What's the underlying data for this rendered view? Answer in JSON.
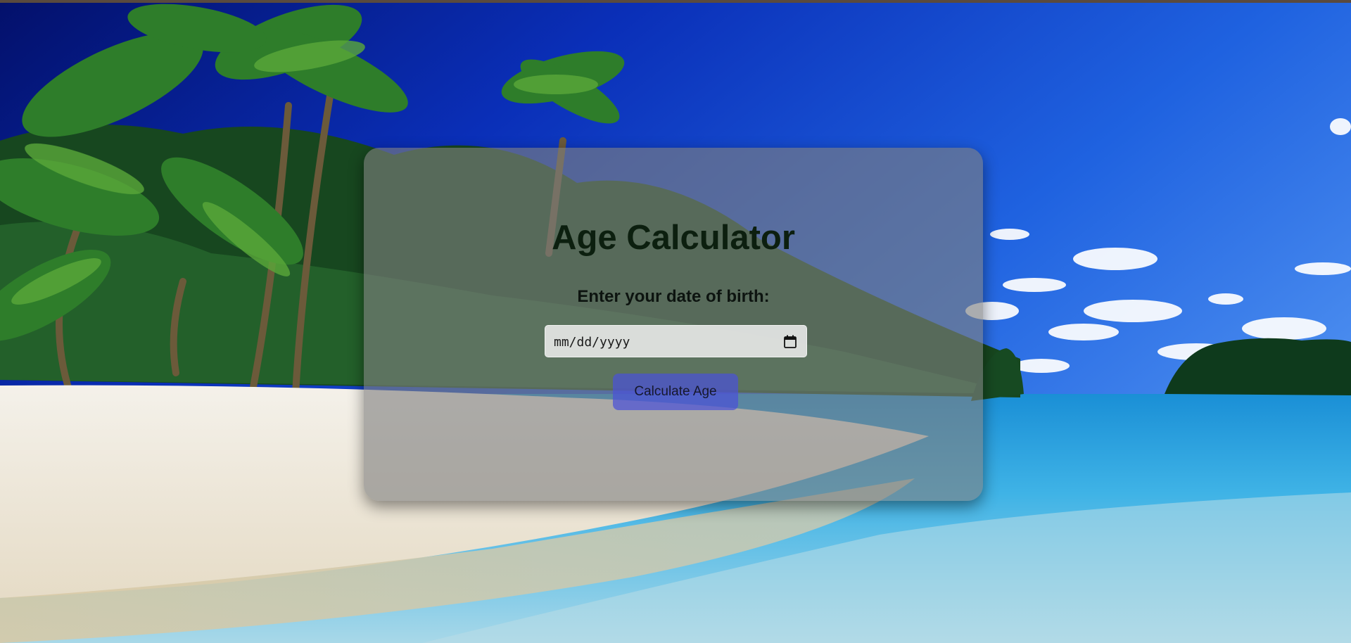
{
  "app": {
    "title": "Age Calculator",
    "dob_label": "Enter your date of birth:",
    "date_placeholder": "mm/dd/yyyy",
    "date_value": "",
    "button_label": "Calculate Age"
  },
  "icons": {
    "date_picker": "calendar-icon"
  },
  "colors": {
    "button": "#4b52d7",
    "card": "#808080",
    "sky": "#1f5bd8",
    "sea": "#2aa6e0",
    "sand": "#efe9dc"
  }
}
